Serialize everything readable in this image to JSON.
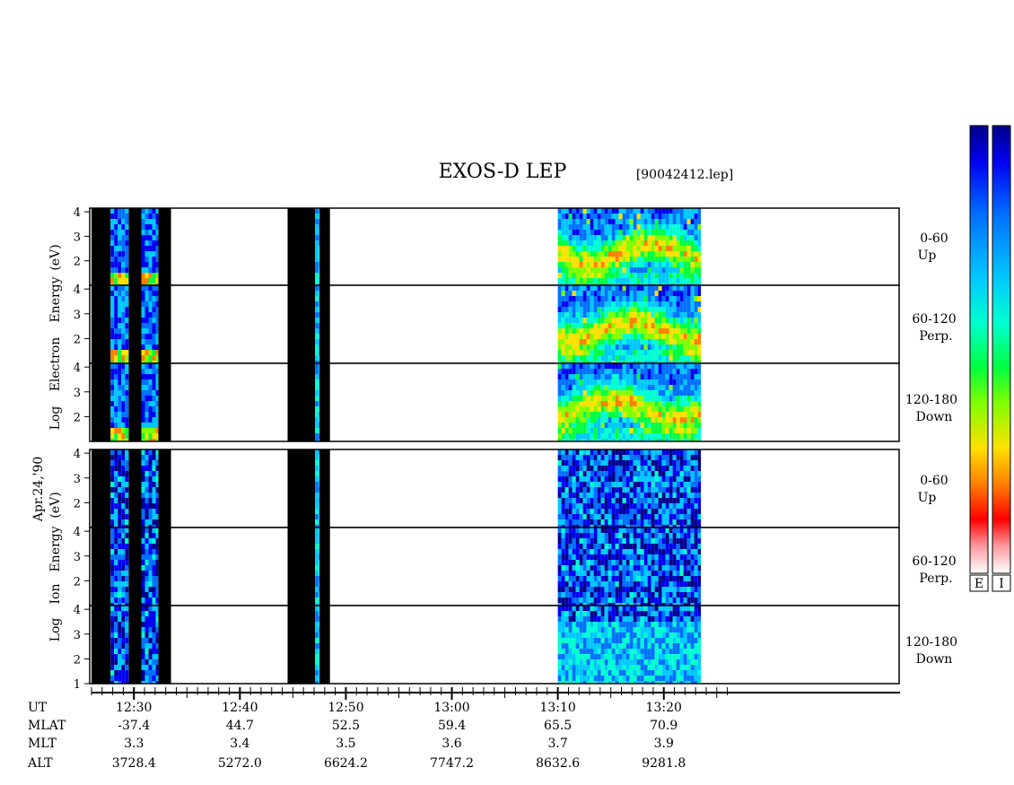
{
  "title": "EXOS-D LEP",
  "file_label": "[90042412.lep]",
  "date_label": "Apr.24,'90",
  "colorbar_labels": [
    "E",
    "I"
  ],
  "colormap": [
    "#ffffff",
    "#ff9aa0",
    "#ff0000",
    "#ff8000",
    "#ffe000",
    "#80ff00",
    "#00ff40",
    "#00ffd0",
    "#00c8ff",
    "#0070ff",
    "#0000f0",
    "#00008a"
  ],
  "colors": {
    "no_data": "#000000",
    "background": "#ffffff"
  },
  "panels": [
    {
      "id": "electron",
      "ylabel_lines": [
        "Log",
        "Electron",
        "Energy",
        "(eV)"
      ],
      "yticks": [
        4,
        3,
        2
      ],
      "yticks_bottom": [
        4,
        3,
        2
      ],
      "channels": [
        {
          "label_range": "0-60",
          "label_dir": "Up"
        },
        {
          "label_range": "60-120",
          "label_dir": "Perp."
        },
        {
          "label_range": "120-180",
          "label_dir": "Down"
        }
      ]
    },
    {
      "id": "ion",
      "ylabel_lines": [
        "Log",
        "Ion",
        "Energy",
        "(eV)"
      ],
      "yticks": [
        4,
        3,
        2
      ],
      "yticks_bottom": [
        4,
        3,
        2,
        1
      ],
      "channels": [
        {
          "label_range": "0-60",
          "label_dir": "Up"
        },
        {
          "label_range": "60-120",
          "label_dir": "Perp."
        },
        {
          "label_range": "120-180",
          "label_dir": "Down"
        }
      ]
    }
  ],
  "chart_data": {
    "type": "heatmap",
    "title": "EXOS-D LEP",
    "xlabel": "UT",
    "ylabel_electron": "Log Electron Energy (eV)",
    "ylabel_ion": "Log Ion Energy (eV)",
    "x_tick_labels": [
      "12:30",
      "12:40",
      "12:50",
      "13:00",
      "13:10",
      "13:20"
    ],
    "ephemeris": [
      {
        "name": "UT",
        "values": [
          "12:30",
          "12:40",
          "12:50",
          "13:00",
          "13:10",
          "13:20"
        ]
      },
      {
        "name": "MLAT",
        "values": [
          "-37.4",
          "44.7",
          "52.5",
          "59.4",
          "65.5",
          "70.9"
        ]
      },
      {
        "name": "MLT",
        "values": [
          "3.3",
          "3.4",
          "3.5",
          "3.6",
          "3.7",
          "3.9"
        ]
      },
      {
        "name": "ALT",
        "values": [
          "3728.4",
          "5272.0",
          "6624.2",
          "7747.2",
          "8632.6",
          "9281.8"
        ]
      }
    ],
    "data_intervals_ut": [
      [
        "12:27.8",
        "12:29.5"
      ],
      [
        "12:30.7",
        "12:32.3"
      ],
      [
        "12:47.1",
        "12:47.5"
      ],
      [
        "13:10.0",
        "13:23.5"
      ]
    ],
    "no_data_intervals_ut": [
      [
        "12:26.0",
        "12:27.8"
      ],
      [
        "12:29.5",
        "12:30.7"
      ],
      [
        "12:32.3",
        "12:33.5"
      ],
      [
        "12:44.5",
        "12:47.1"
      ],
      [
        "12:47.5",
        "12:48.5"
      ]
    ]
  }
}
